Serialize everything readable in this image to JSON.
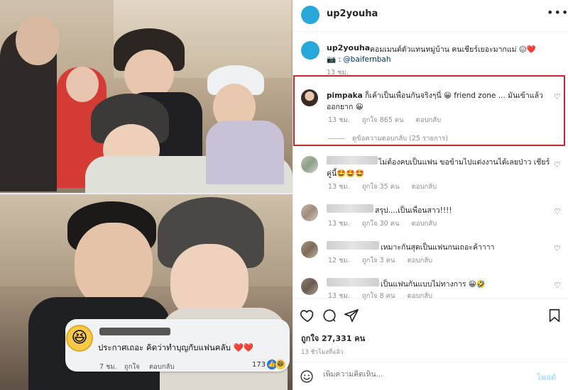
{
  "header": {
    "username": "up2youha"
  },
  "caption": {
    "username": "up2youha",
    "text": "คอมเมนต์ตัวแทนหมู่บ้าน คนเชียร์เยอะมากแม่ 😖❤️",
    "credit_icon": "camera-icon",
    "mention": ": @baifernbah",
    "time": "13 ชม."
  },
  "comments": [
    {
      "username": "pimpaka",
      "line1": "ก็เค้าเป็นเพื่อนกันจริงๆนี่ 😀 friend zone ... มันเข้าแล้ว",
      "line2": "ออกยาก 😀",
      "time": "13 ชม.",
      "likes": "ถูกใจ 865 คน",
      "reply": "ตอบกลับ",
      "view_replies": "ดูข้อความตอบกลับ (25 รายการ)",
      "highlighted": true
    },
    {
      "line1": "ไม่ต้องคบเป็นแฟน ขอข้ามไปแต่งงานได้เลยป่าว เชียร์",
      "line2": "คู่นี้🤩🤩🤩",
      "time": "13 ชม.",
      "likes": "ถูกใจ 35 คน",
      "reply": "ตอบกลับ"
    },
    {
      "line1": "สรุป....เป็นเพื่อนสาว!!!!",
      "time": "13 ชม.",
      "likes": "ถูกใจ 30 คน",
      "reply": "ตอบกลับ"
    },
    {
      "line1": "เหมาะกันสุดเป็นแฟนกนเถอะค้าาาา",
      "time": "12 ชม.",
      "likes": "ถูกใจ 3 คน",
      "reply": "ตอบกลับ"
    },
    {
      "line1": "เป็นแฟนกันแบบไม่ทางการ 😀🤣",
      "time": "13 ชม.",
      "likes": "ถูกใจ 8 คน",
      "reply": "ตอบกลับ"
    }
  ],
  "actions": {
    "likes": "ถูกใจ 27,331 คน",
    "time": "13 ชั่วโมงที่แล้ว"
  },
  "input": {
    "placeholder": "เพิ่มความคิดเห็น...",
    "post_label": "โพสต์"
  },
  "fb_comment": {
    "emoji": "😆",
    "text": "ประกาศเถอะ คิดว่าทำบุญกับแฟนคลับ ❤️❤️",
    "time": "7 ชม.",
    "like": "ถูกใจ",
    "reply": "ตอบกลับ",
    "reaction_count": "173"
  },
  "colors": {
    "highlight_border": "#c4282c",
    "avatar_blue": "#2aa7d9",
    "post_disabled": "#b2dffc"
  }
}
